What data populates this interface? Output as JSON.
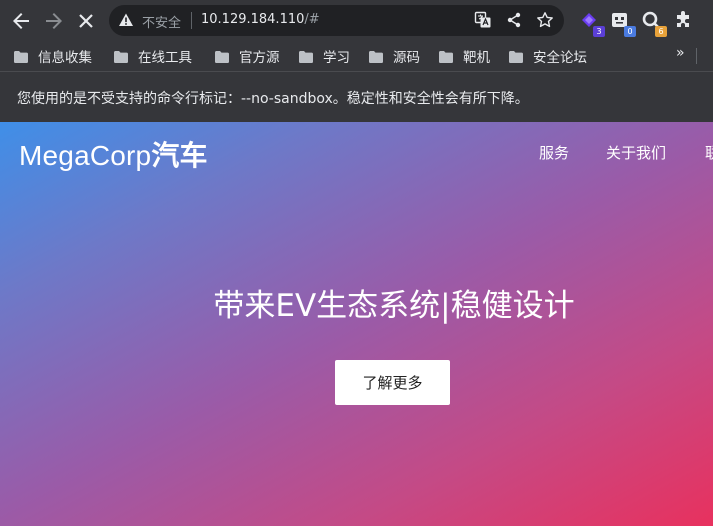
{
  "browser": {
    "security_label": "不安全",
    "url_host": "10.129.184.110",
    "url_rest": "/#",
    "extensions": [
      {
        "icon": "extension-icon-purple",
        "badge": "3",
        "badge_color": "#5b3fd6"
      },
      {
        "icon": "extension-icon-robot",
        "badge": "0",
        "badge_color": "#4a7be0"
      },
      {
        "icon": "extension-icon-search",
        "badge": "6",
        "badge_color": "#e8a23a"
      }
    ]
  },
  "bookmarks": [
    {
      "label": "信息收集"
    },
    {
      "label": "在线工具"
    },
    {
      "label": "官方源"
    },
    {
      "label": "学习"
    },
    {
      "label": "源码"
    },
    {
      "label": "靶机"
    },
    {
      "label": "安全论坛"
    }
  ],
  "bookmarks_more": "»",
  "infobar": {
    "message": "您使用的是不受支持的命令行标记：--no-sandbox。稳定性和安全性会有所下降。"
  },
  "site": {
    "brand_latin": "MegaCorp",
    "brand_cjk": "汽车",
    "nav": [
      "服务",
      "关于我们",
      "联"
    ],
    "hero_title": "带来EV生态系统|稳健设计",
    "hero_button": "了解更多"
  }
}
